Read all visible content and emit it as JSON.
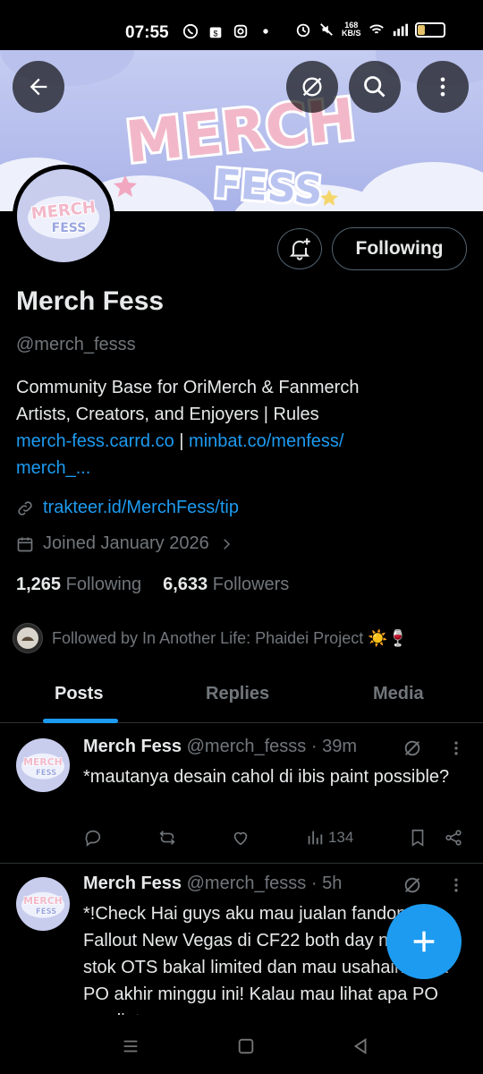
{
  "status_bar": {
    "time": "07:55",
    "net_speed_value": "168",
    "net_speed_unit": "KB/S",
    "battery": "36",
    "battery_level": 0.36
  },
  "banner": {
    "logo_line1": "MERCH",
    "logo_line2": "FESS"
  },
  "top_actions": {
    "back_icon": "arrow-left-icon",
    "grok_icon": "grok-icon",
    "search_icon": "search-icon",
    "more_icon": "more-vertical-icon"
  },
  "profile": {
    "avatar_text_line1": "MERCH",
    "avatar_text_line2": "FESS",
    "following_button": "Following",
    "name": "Merch Fess",
    "handle": "@merch_fesss",
    "bio_line1": "Community Base for OriMerch & Fanmerch",
    "bio_line2": "Artists, Creators, and Enjoyers | Rules",
    "bio_link1": "merch-fess.carrd.co",
    "bio_sep": " | ",
    "bio_link2": "minbat.co/menfess/",
    "bio_link3": "merch_...",
    "website": "trakteer.id/MerchFess/tip",
    "joined": "Joined January 2026",
    "following_count": "1,265",
    "following_label": "Following",
    "followers_count": "6,633",
    "followers_label": "Followers",
    "followed_by": "Followed by In Another Life: Phaidei Project ☀️🍷"
  },
  "tabs": [
    {
      "label": "Posts",
      "active": true
    },
    {
      "label": "Replies",
      "active": false
    },
    {
      "label": "Media",
      "active": false
    }
  ],
  "tweets": [
    {
      "name": "Merch Fess",
      "handle": "@merch_fesss",
      "time": "· 39m",
      "text": "*mautanya desain cahol di ibis paint possible?",
      "views": "134"
    },
    {
      "name": "Merch Fess",
      "handle": "@merch_fesss",
      "time": "· 5h",
      "text": "*!Check Hai guys aku mau jualan fandom Fallout New Vegas di CF22 both day nanti :3c stok OTS bakal limited dan mau usahain buka PO akhir minggu ini! Kalau mau lihat apa PO nya liat..."
    }
  ],
  "colors": {
    "accent": "#1d9bf0",
    "muted": "#71767b",
    "text": "#e7e9ea",
    "banner": "#aab3e8"
  }
}
